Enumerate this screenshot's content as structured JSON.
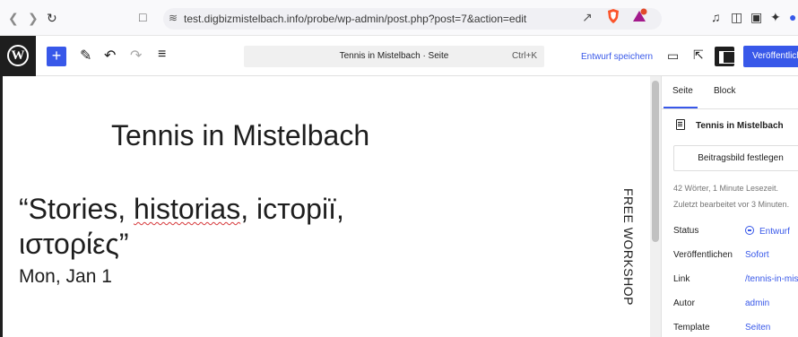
{
  "browser": {
    "back_icon": "back-arrow-icon",
    "forward_icon": "forward-arrow-icon",
    "reload_icon": "reload-icon",
    "url": "test.digbizmistelbach.info/probe/wp-admin/post.php?post=7&action=edit"
  },
  "toolbar": {
    "document_title": "Tennis in Mistelbach · Seite",
    "shortcut": "Ctrl+K",
    "save_draft": "Entwurf speichern",
    "publish": "Veröffentlichen"
  },
  "canvas": {
    "title": "Tennis in Mistelbach",
    "quote_open": "“Stories, ",
    "quote_misspelled": "historias",
    "quote_rest": ", історії, ιστορίες”",
    "date": "Mon, Jan 1",
    "vertical_text": "FREE WORKSHOP"
  },
  "sidebar": {
    "tabs": [
      "Seite",
      "Block"
    ],
    "page_name": "Tennis in Mistelbach",
    "featured_image_button": "Beitragsbild festlegen",
    "word_count": "42 Wörter, 1 Minute Lesezeit.",
    "last_edited": "Zuletzt bearbeitet vor 3 Minuten.",
    "rows": [
      {
        "label": "Status",
        "value": "Entwurf"
      },
      {
        "label": "Veröffentlichen",
        "value": "Sofort"
      },
      {
        "label": "Link",
        "value": "/tennis-in-mistelbach/"
      },
      {
        "label": "Autor",
        "value": "admin"
      },
      {
        "label": "Template",
        "value": "Seiten"
      }
    ]
  },
  "colors": {
    "accent": "#3858e9",
    "dark": "#1e1e1e"
  }
}
